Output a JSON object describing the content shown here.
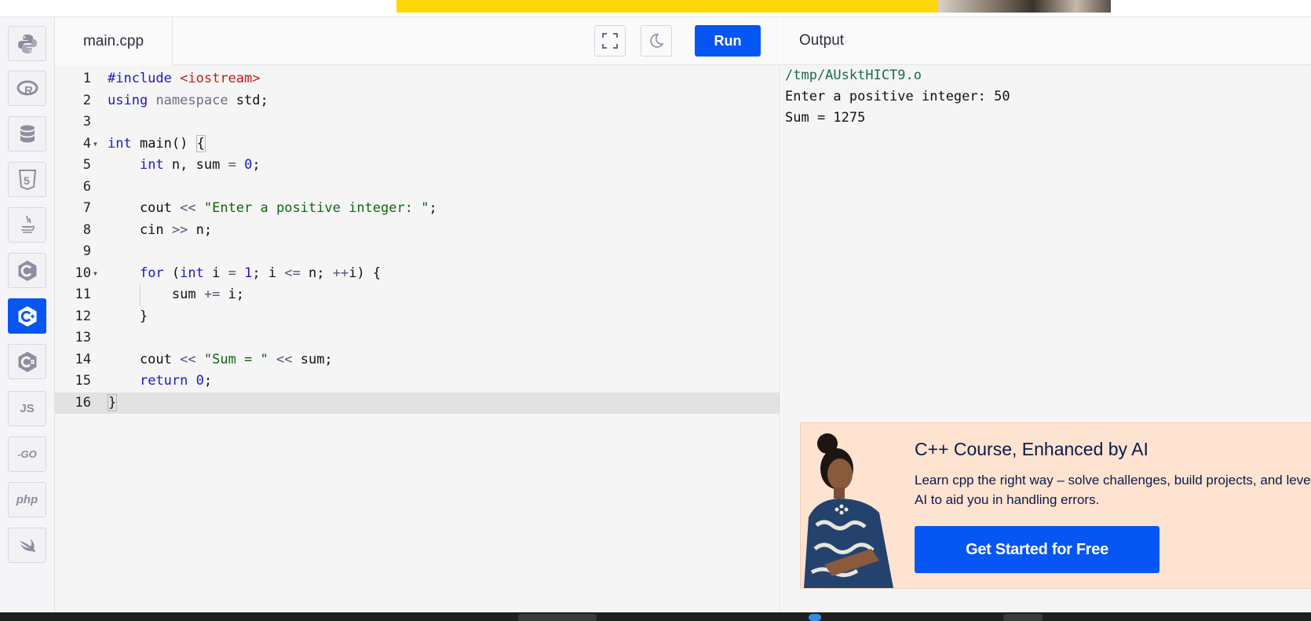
{
  "editor": {
    "file_name": "main.cpp",
    "run_label": "Run",
    "fullscreen_icon": "fullscreen-icon",
    "theme_icon": "moon-icon",
    "line_numbers": [
      "1",
      "2",
      "3",
      "4",
      "5",
      "6",
      "7",
      "8",
      "9",
      "10",
      "11",
      "12",
      "13",
      "14",
      "15",
      "16"
    ],
    "current_line": 16
  },
  "sidebar": {
    "languages": [
      {
        "name": "python",
        "icon": "python-icon",
        "label": ""
      },
      {
        "name": "r",
        "icon": "r-icon",
        "label": ""
      },
      {
        "name": "sql",
        "icon": "database-icon",
        "label": ""
      },
      {
        "name": "html",
        "icon": "html5-icon",
        "label": "5"
      },
      {
        "name": "java",
        "icon": "java-icon",
        "label": ""
      },
      {
        "name": "c",
        "icon": "c-icon",
        "label": ""
      },
      {
        "name": "cpp",
        "icon": "cpp-icon",
        "label": "",
        "active": true
      },
      {
        "name": "csharp",
        "icon": "csharp-icon",
        "label": ""
      },
      {
        "name": "javascript",
        "icon": "js-icon",
        "label": "JS"
      },
      {
        "name": "go",
        "icon": "go-icon",
        "label": "-GO"
      },
      {
        "name": "php",
        "icon": "php-icon",
        "label": "php"
      },
      {
        "name": "swift",
        "icon": "swift-icon",
        "label": ""
      }
    ]
  },
  "output": {
    "title": "Output",
    "lines": [
      "/tmp/AUsktHICT9.o",
      "Enter a positive integer: 50",
      "Sum = 1275"
    ]
  },
  "ad": {
    "title": "C++ Course, Enhanced by AI",
    "description": "Learn cpp the right way – solve challenges, build projects, and leverage AI to aid you in handling errors.",
    "cta": "Get Started for Free"
  },
  "colors": {
    "accent": "#0556f3",
    "ad_background": "#ffe3d1",
    "banner": "#ffd60a"
  }
}
